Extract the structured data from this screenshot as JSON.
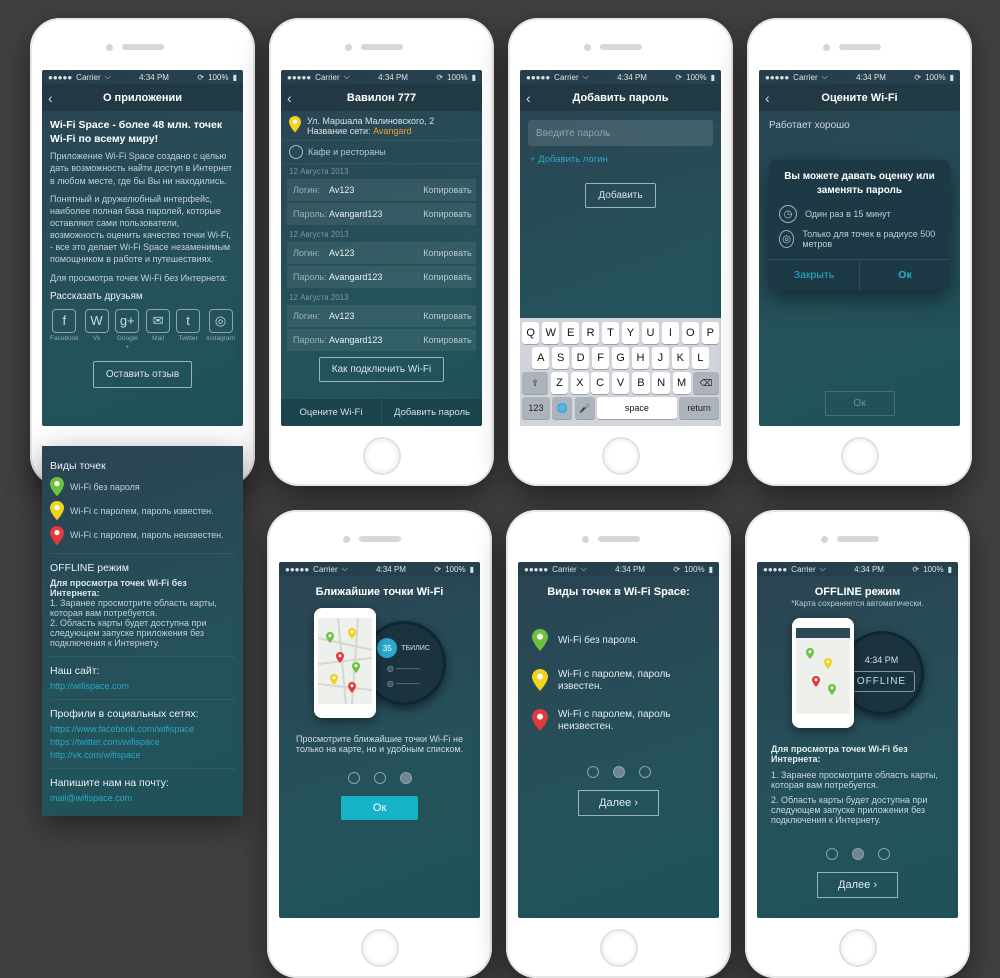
{
  "status": {
    "carrier": "Carrier",
    "time": "4:34 PM",
    "battery": "100%"
  },
  "s1": {
    "title": "О приложении",
    "headline": "Wi-Fi Space - более 48 млн. точек Wi-Fi по всему миру!",
    "p1": "Приложение Wi-Fi Space создано с целью дать возможность найти доступ в Интернет в любом месте, где бы Вы ни находились.",
    "p2": "Понятный и дружелюбный интерфейс, наиболее полная база паролей, которые оставляют сами пользователи, возможность оценить качество точки Wi-Fi, - все это делает Wi-Fi Space незаменимым помощником в работе и путешествиях.",
    "p3": "Для просмотра точек Wi-Fi без Интернета:",
    "share_title": "Рассказать друзьям",
    "share": [
      "Facebook",
      "Vk",
      "Google +",
      "Mail",
      "Twitter",
      "Instagram"
    ],
    "leave_review": "Оставить отзыв",
    "types_title": "Виды точек",
    "types": [
      "Wi-Fi без пароля",
      "Wi-Fi с паролем, пароль известен.",
      "Wi-Fi с паролем, пароль неизвестен."
    ],
    "offline_title": "OFFLINE режим",
    "offline_intro": "Для просмотра точек Wi-Fi без Интернета:",
    "offline_steps": [
      "1. Заранее просмотрите область карты, которая вам потребуется.",
      "2. Область карты будет доступна при следующем запуске приложения без подключения к Интернету."
    ],
    "site_title": "Наш сайт:",
    "site_link": "http://wifispace.com",
    "social_title": "Профили в социальных сетях:",
    "social_links": [
      "https://www.facebook.com/wifispace",
      "https://twitter.com/wifispace",
      "http://vk.com/wifispace"
    ],
    "mail_title": "Напишите нам на почту:",
    "mail_link": "mail@wifispace.com"
  },
  "s2": {
    "title": "Вавилон  777",
    "address": "Ул. Маршала Малиновского, 2",
    "net_label": "Название сети:",
    "net_name": "Avangard",
    "category": "Кафе и рестораны",
    "date": "12 Августа 2013",
    "login_k": "Логин:",
    "login_v": "Av123",
    "pass_k": "Пароль:",
    "pass_v": "Avangard123",
    "copy": "Копировать",
    "howto": "Как подключить Wi-Fi",
    "rate": "Оцените Wi-Fi",
    "add_pass": "Добавить пароль"
  },
  "s3": {
    "title": "Добавить пароль",
    "placeholder": "Введите пароль",
    "add_login": "+ Добавить логин",
    "add_btn": "Добавить",
    "kb_r1": [
      "Q",
      "W",
      "E",
      "R",
      "T",
      "Y",
      "U",
      "I",
      "O",
      "P"
    ],
    "kb_r2": [
      "A",
      "S",
      "D",
      "F",
      "G",
      "H",
      "J",
      "K",
      "L"
    ],
    "kb_r3": [
      "Z",
      "X",
      "C",
      "V",
      "B",
      "N",
      "M"
    ],
    "kb_shift": "⇧",
    "kb_del": "⌫",
    "kb_123": "123",
    "kb_globe": "🌐",
    "kb_mic": "🎤",
    "kb_space": "space",
    "kb_return": "return"
  },
  "s4": {
    "title": "Оцените Wi-Fi",
    "works": "Работает хорошо",
    "modal_title": "Вы можете давать оценку или заменять пароль",
    "cond1": "Один раз в 15 минут",
    "cond2": "Только для точек в радиусе 500 метров",
    "close": "Закрыть",
    "ok": "Ок"
  },
  "s5": {
    "title": "Ближайшие точки Wi-Fi",
    "desc": "Просмотрите ближайшие точки Wi-Fi не только на карте, но и удобным списком.",
    "ok": "Ок",
    "list_label": "ТБИЛИС",
    "count": "35"
  },
  "s6": {
    "title": "Виды точек в Wi-Fi Space:",
    "t1": "Wi-Fi без пароля.",
    "t2": "Wi-Fi с паролем, пароль известен.",
    "t3": "Wi-Fi с паролем, пароль неизвестен.",
    "next": "Далее"
  },
  "s7": {
    "title": "OFFLINE режим",
    "sub": "*Карта сохраняется автоматически.",
    "time": "4:34 PM",
    "badge": "OFFLINE",
    "intro": "Для просмотра точек Wi-Fi без Интернета:",
    "steps": [
      "1. Заранее просмотрите область карты, которая вам потребуется.",
      "2. Область карты будет доступна при следующем запуске приложения без подключения к Интернету."
    ],
    "next": "Далее"
  },
  "chevron": "›"
}
